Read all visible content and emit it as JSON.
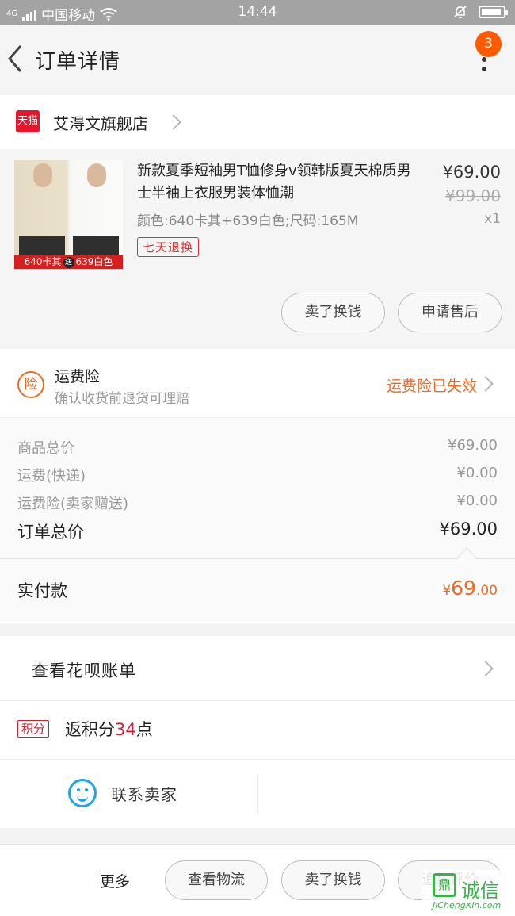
{
  "status_bar": {
    "network_tag": "4G",
    "carrier": "中国移动",
    "time": "14:44"
  },
  "nav": {
    "title": "订单详情",
    "notification_count": "3"
  },
  "shop": {
    "platform_logo": "天猫",
    "name": "艾淂文旗舰店"
  },
  "product": {
    "title": "新款夏季短袖男T恤修身v领韩版夏天棉质男士半袖上衣服男装体恤潮",
    "attributes": "颜色:640卡其+639白色;尺码:165M",
    "price": "¥69.00",
    "original_price": "¥99.00",
    "quantity": "x1",
    "return_badge": "七天退换",
    "image_tag_left": "640卡其",
    "image_tag_mid": "送",
    "image_tag_right": "639白色",
    "actions": {
      "sell_label": "卖了换钱",
      "after_sale_label": "申请售后"
    }
  },
  "insurance": {
    "icon_char": "险",
    "title": "运费险",
    "subtitle": "确认收货前退货可理赔",
    "status": "运费险已失效"
  },
  "summary": {
    "rows": [
      {
        "label": "商品总价",
        "value": "¥69.00"
      },
      {
        "label": "运费(快递)",
        "value": "¥0.00"
      },
      {
        "label": "运费险(卖家赠送)",
        "value": "¥0.00"
      }
    ],
    "total_label": "订单总价",
    "total_value": "¥69.00",
    "paid_label": "实付款",
    "paid_currency": "¥",
    "paid_integer": "69",
    "paid_decimal": ".00"
  },
  "huabei": {
    "label": "查看花呗账单"
  },
  "points": {
    "tag": "积分",
    "prefix": "返积分",
    "count": "34",
    "suffix": "点"
  },
  "contact": {
    "label": "联系卖家"
  },
  "bottom_bar": {
    "more_label": "更多",
    "buttons": [
      "查看物流",
      "卖了换钱",
      "追加评价"
    ]
  },
  "watermark": {
    "text": "诚信",
    "mark": "鼎",
    "url": "JiChengXin.com"
  },
  "colors": {
    "accent": "#f06a21",
    "tmall_red": "#e5162c",
    "badge_orange": "#ff5a00",
    "points_red": "#d31f32",
    "contact_blue": "#1ea6e6"
  }
}
